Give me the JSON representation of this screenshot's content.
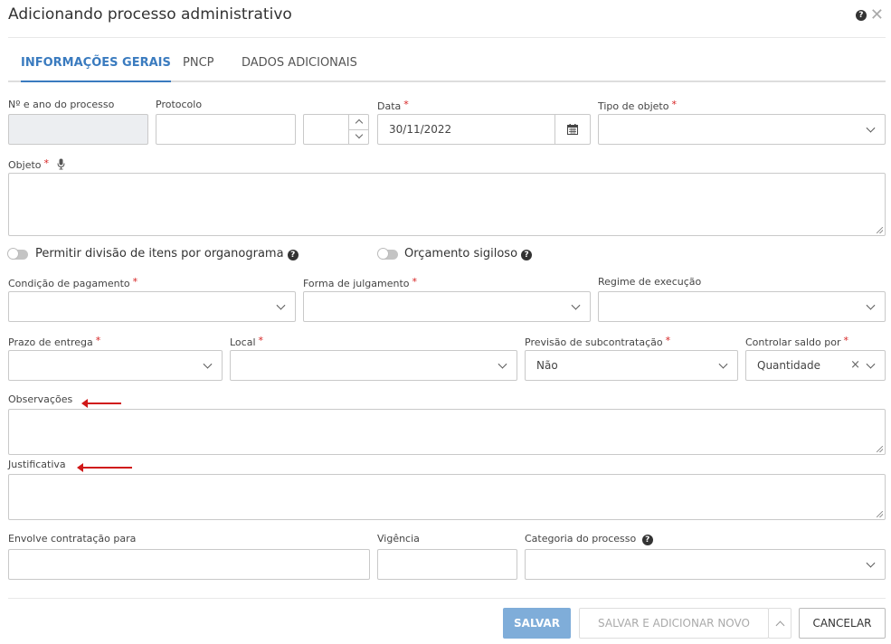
{
  "dialog": {
    "title": "Adicionando processo administrativo",
    "help_glyph": "?",
    "close_glyph": "✕"
  },
  "tabs": [
    {
      "label": "INFORMAÇÕES GERAIS",
      "active": true
    },
    {
      "label": "PNCP",
      "active": false
    },
    {
      "label": "DADOS ADICIONAIS",
      "active": false
    }
  ],
  "fields": {
    "numero": {
      "label": "Nº e ano do processo",
      "value": ""
    },
    "protocolo": {
      "label": "Protocolo",
      "value": ""
    },
    "protocolo_ano": {
      "value": ""
    },
    "data": {
      "label": "Data",
      "value": "30/11/2022"
    },
    "tipo_objeto": {
      "label": "Tipo de objeto",
      "value": ""
    },
    "objeto": {
      "label": "Objeto",
      "value": ""
    },
    "condicao_pagamento": {
      "label": "Condição de pagamento",
      "value": ""
    },
    "forma_julgamento": {
      "label": "Forma de julgamento",
      "value": ""
    },
    "regime_execucao": {
      "label": "Regime de execução",
      "value": ""
    },
    "prazo_entrega": {
      "label": "Prazo de entrega",
      "value": ""
    },
    "local": {
      "label": "Local",
      "value": ""
    },
    "previsao_subcontratacao": {
      "label": "Previsão de subcontratação",
      "value": "Não"
    },
    "controlar_saldo": {
      "label": "Controlar saldo por",
      "value": "Quantidade"
    },
    "observacoes": {
      "label": "Observações",
      "value": ""
    },
    "justificativa": {
      "label": "Justificativa",
      "value": ""
    },
    "envolve_contratacao": {
      "label": "Envolve contratação para",
      "value": ""
    },
    "vigencia": {
      "label": "Vigência",
      "value": ""
    },
    "categoria_processo": {
      "label": "Categoria do processo",
      "value": ""
    }
  },
  "toggles": {
    "divisao": {
      "label": "Permitir divisão de itens por organograma",
      "on": false
    },
    "sigiloso": {
      "label": "Orçamento sigiloso",
      "on": false
    }
  },
  "required_marker": "*",
  "clear_glyph": "×",
  "buttons": {
    "save": "SALVAR",
    "save_new": "SALVAR E ADICIONAR NOVO",
    "cancel": "CANCELAR"
  },
  "colors": {
    "accent": "#3a7bbf",
    "save_button": "#7fadd9",
    "required": "#d62222",
    "annotation_arrow": "#d01818"
  },
  "icons": [
    "help-icon",
    "close-icon",
    "calendar-icon",
    "microphone-icon",
    "chevron-down-icon",
    "spinner-up-icon",
    "spinner-down-icon",
    "clear-icon",
    "chevron-up-icon"
  ]
}
